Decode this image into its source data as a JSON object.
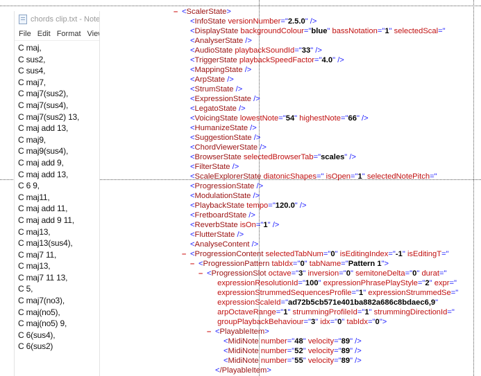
{
  "notepad": {
    "title": "chords clip.txt - Notep",
    "menu": [
      "File",
      "Edit",
      "Format",
      "View"
    ],
    "lines": [
      "C maj,",
      "C sus2,",
      "C sus4,",
      "C maj7,",
      "C maj7(sus2),",
      "C maj7(sus4),",
      "C maj7(sus2) 13,",
      "C maj add 13,",
      "C maj9,",
      "C maj9(sus4),",
      "C maj add 9,",
      "C maj add 13,",
      "C 6 9,",
      "C maj11,",
      "C maj add 11,",
      "C maj add 9 11,",
      "C maj13,",
      "C maj13(sus4),",
      "C maj7 11,",
      "C maj13,",
      "C maj7 11 13,",
      "C 5,",
      "C maj7(no3),",
      "C maj(no5),",
      "C maj(no5) 9,",
      "C 6(sus4),",
      "C 6(sus2)"
    ]
  },
  "xml_lines": [
    {
      "indent": 0,
      "marker": "–",
      "name": "ScalerState",
      "attrs": [],
      "close": ">"
    },
    {
      "indent": 1,
      "marker": "",
      "name": "InfoState",
      "attrs": [
        {
          "n": "versionNumber",
          "v": "2.5.0"
        }
      ],
      "close": " />"
    },
    {
      "indent": 1,
      "marker": "",
      "name": "DisplayState",
      "attrs": [
        {
          "n": "backgroundColour",
          "v": "blue"
        },
        {
          "n": "bassNotation",
          "v": "1"
        },
        {
          "n": "selectedScal",
          "v": ""
        }
      ],
      "close": ""
    },
    {
      "indent": 1,
      "marker": "",
      "name": "AnalyserState",
      "attrs": [],
      "close": " />"
    },
    {
      "indent": 1,
      "marker": "",
      "name": "AudioState",
      "attrs": [
        {
          "n": "playbackSoundId",
          "v": "33"
        }
      ],
      "close": " />"
    },
    {
      "indent": 1,
      "marker": "",
      "name": "TriggerState",
      "attrs": [
        {
          "n": "playbackSpeedFactor",
          "v": "4.0"
        }
      ],
      "close": " />"
    },
    {
      "indent": 1,
      "marker": "",
      "name": "MappingState",
      "attrs": [],
      "close": " />"
    },
    {
      "indent": 1,
      "marker": "",
      "name": "ArpState",
      "attrs": [],
      "close": " />"
    },
    {
      "indent": 1,
      "marker": "",
      "name": "StrumState",
      "attrs": [],
      "close": " />"
    },
    {
      "indent": 1,
      "marker": "",
      "name": "ExpressionState",
      "attrs": [],
      "close": " />"
    },
    {
      "indent": 1,
      "marker": "",
      "name": "LegatoState",
      "attrs": [],
      "close": " />"
    },
    {
      "indent": 1,
      "marker": "",
      "name": "VoicingState",
      "attrs": [
        {
          "n": "lowestNote",
          "v": "54"
        },
        {
          "n": "highestNote",
          "v": "66"
        }
      ],
      "close": " />"
    },
    {
      "indent": 1,
      "marker": "",
      "name": "HumanizeState",
      "attrs": [],
      "close": " />"
    },
    {
      "indent": 1,
      "marker": "",
      "name": "SuggestionState",
      "attrs": [],
      "close": " />"
    },
    {
      "indent": 1,
      "marker": "",
      "name": "ChordViewerState",
      "attrs": [],
      "close": " />"
    },
    {
      "indent": 1,
      "marker": "",
      "name": "BrowserState",
      "attrs": [
        {
          "n": "selectedBrowserTab",
          "v": "scales"
        }
      ],
      "close": " />"
    },
    {
      "indent": 1,
      "marker": "",
      "name": "FilterState",
      "attrs": [],
      "close": " />"
    },
    {
      "indent": 1,
      "marker": "",
      "name": "ScaleExplorerState",
      "attrs": [
        {
          "n": "diatonicShapes",
          "v": ""
        },
        {
          "n": "isOpen",
          "v": "1"
        },
        {
          "n": "selectedNotePitch",
          "v": ""
        }
      ],
      "close": ""
    },
    {
      "indent": 1,
      "marker": "",
      "name": "ProgressionState",
      "attrs": [],
      "close": " />"
    },
    {
      "indent": 1,
      "marker": "",
      "name": "ModulationState",
      "attrs": [],
      "close": " />"
    },
    {
      "indent": 1,
      "marker": "",
      "name": "PlaybackState",
      "attrs": [
        {
          "n": "tempo",
          "v": "120.0"
        }
      ],
      "close": " />"
    },
    {
      "indent": 1,
      "marker": "",
      "name": "FretboardState",
      "attrs": [],
      "close": " />"
    },
    {
      "indent": 1,
      "marker": "",
      "name": "ReverbState",
      "attrs": [
        {
          "n": "isOn",
          "v": "1"
        }
      ],
      "close": " />"
    },
    {
      "indent": 1,
      "marker": "",
      "name": "FlutterState",
      "attrs": [],
      "close": " />"
    },
    {
      "indent": 1,
      "marker": "",
      "name": "AnalyseContent",
      "attrs": [],
      "close": " />"
    },
    {
      "indent": 1,
      "marker": "–",
      "name": "ProgressionContent",
      "attrs": [
        {
          "n": "selectedTabNum",
          "v": "0"
        },
        {
          "n": "isEditingIndex",
          "v": "-1"
        },
        {
          "n": "isEditingT",
          "v": ""
        }
      ],
      "close": ""
    },
    {
      "indent": 2,
      "marker": "–",
      "name": "ProgressionPattern",
      "attrs": [
        {
          "n": "tabIdx",
          "v": "0"
        },
        {
          "n": "tabName",
          "v": "Pattern 1"
        }
      ],
      "close": ">"
    },
    {
      "indent": 3,
      "marker": "–",
      "name": "ProgressionSlot",
      "attrs": [
        {
          "n": "octave",
          "v": "3"
        },
        {
          "n": "inversion",
          "v": "0"
        },
        {
          "n": "semitoneDelta",
          "v": "0"
        },
        {
          "n": "durat",
          "v": ""
        }
      ],
      "close": ""
    },
    {
      "indent": 4,
      "marker": "",
      "name": "",
      "attrs": [
        {
          "n": "expressionResolutionId",
          "v": "100"
        },
        {
          "n": "expressionPhrasePlayStyle",
          "v": "2"
        },
        {
          "n": "expr",
          "v": ""
        }
      ],
      "close": ""
    },
    {
      "indent": 4,
      "marker": "",
      "name": "",
      "attrs": [
        {
          "n": "expressionStrummedSequencesProfile",
          "v": "1"
        },
        {
          "n": "expressionStrummedSe",
          "v": ""
        }
      ],
      "close": ""
    },
    {
      "indent": 4,
      "marker": "",
      "name": "",
      "attrs": [
        {
          "n": "expressionScaleId",
          "v": "ad72b5cb571e401ba882a686c8bdaec6,9"
        }
      ],
      "close": ""
    },
    {
      "indent": 4,
      "marker": "",
      "name": "",
      "attrs": [
        {
          "n": "arpOctaveRange",
          "v": "1"
        },
        {
          "n": "strummingProfileId",
          "v": "1"
        },
        {
          "n": "strummingDirectionId",
          "v": ""
        }
      ],
      "close": ""
    },
    {
      "indent": 4,
      "marker": "",
      "name": "",
      "attrs": [
        {
          "n": "groupPlaybackBehaviour",
          "v": "3"
        },
        {
          "n": "idx",
          "v": "0"
        },
        {
          "n": "tabIdx",
          "v": "0"
        }
      ],
      "close": ">"
    },
    {
      "indent": 4,
      "marker": "–",
      "name": "PlayableItem",
      "attrs": [],
      "close": ">"
    },
    {
      "indent": 5,
      "marker": "",
      "name": "MidiNote",
      "attrs": [
        {
          "n": "number",
          "v": "48"
        },
        {
          "n": "velocity",
          "v": "89"
        }
      ],
      "close": " />"
    },
    {
      "indent": 5,
      "marker": "",
      "name": "MidiNote",
      "attrs": [
        {
          "n": "number",
          "v": "52"
        },
        {
          "n": "velocity",
          "v": "89"
        }
      ],
      "close": " />"
    },
    {
      "indent": 5,
      "marker": "",
      "name": "MidiNote",
      "attrs": [
        {
          "n": "number",
          "v": "55"
        },
        {
          "n": "velocity",
          "v": "89"
        }
      ],
      "close": " />"
    },
    {
      "indent": 4,
      "marker": "",
      "name": "/PlayableItem",
      "attrs": [],
      "close": ">"
    }
  ]
}
